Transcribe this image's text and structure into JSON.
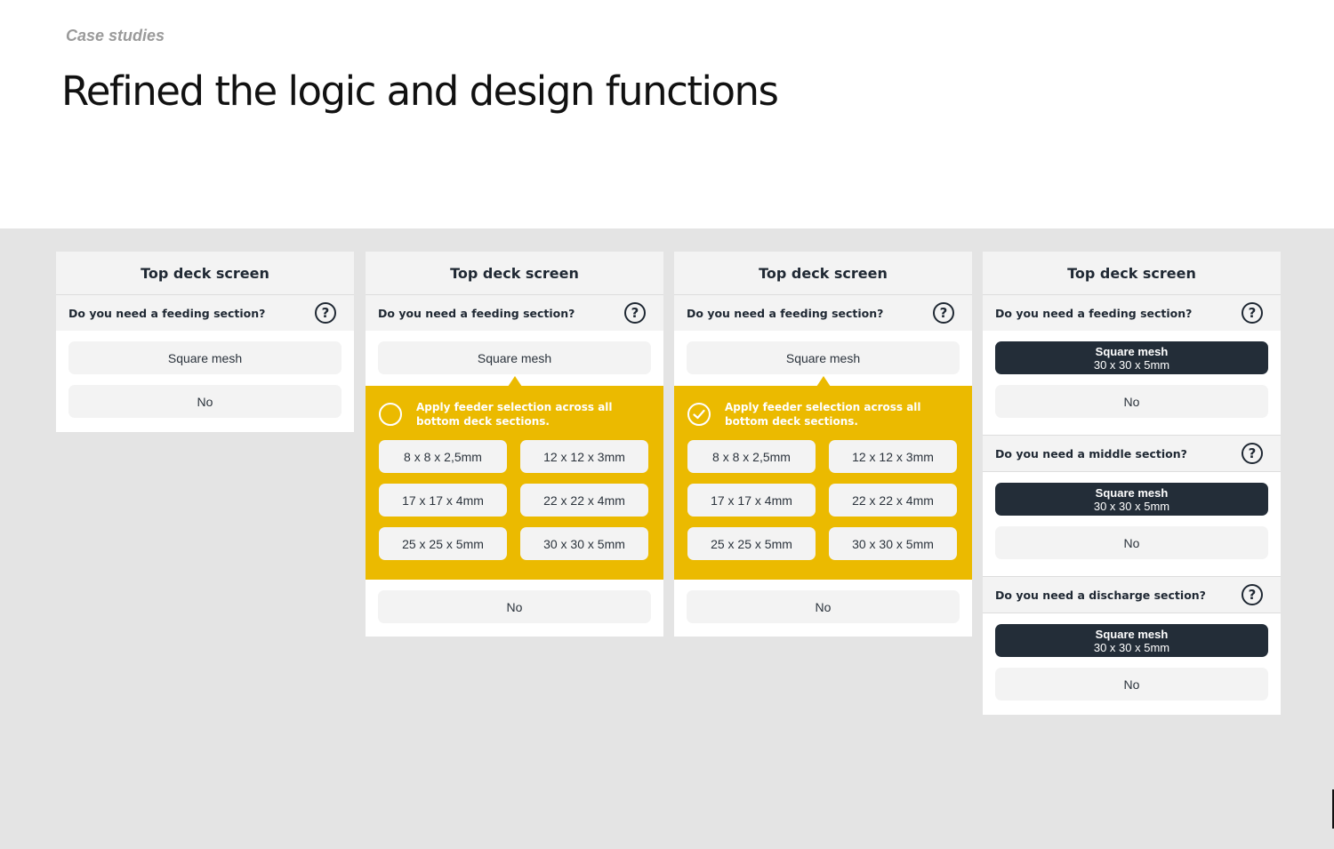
{
  "page": {
    "eyebrow": "Case studies",
    "title": "Refined the logic and design functions"
  },
  "panels": [
    {
      "header": "Top deck screen",
      "question": "Do you need a feeding section?",
      "help": "?",
      "option_square": "Square mesh",
      "option_no": "No"
    },
    {
      "header": "Top deck screen",
      "question": "Do you need a feeding section?",
      "help": "?",
      "option_square": "Square mesh",
      "apply_text": "Apply feeder selection across all bottom deck sections.",
      "apply_checked": false,
      "sizes": [
        "8 x 8 x 2,5mm",
        "12 x 12 x 3mm",
        "17 x 17 x 4mm",
        "22 x 22 x 4mm",
        "25 x 25  x 5mm",
        "30 x 30 x 5mm"
      ],
      "option_no": "No"
    },
    {
      "header": "Top deck screen",
      "question": "Do you need a feeding section?",
      "help": "?",
      "option_square": "Square mesh",
      "apply_text": "Apply feeder selection across all bottom deck sections.",
      "apply_checked": true,
      "sizes": [
        "8 x 8 x 2,5mm",
        "12 x 12 x 3mm",
        "17 x 17 x 4mm",
        "22 x 22 x 4mm",
        "25 x 25  x 5mm",
        "30 x 30 x 5mm"
      ],
      "option_no": "No"
    },
    {
      "header": "Top deck screen",
      "sections": [
        {
          "question": "Do you need a feeding section?",
          "help": "?",
          "selected_label": "Square mesh",
          "selected_size": "30 x 30 x 5mm",
          "option_no": "No"
        },
        {
          "question": "Do you need a middle section?",
          "help": "?",
          "selected_label": "Square mesh",
          "selected_size": "30 x 30 x 5mm",
          "option_no": "No"
        },
        {
          "question": "Do you need a discharge section?",
          "help": "?",
          "selected_label": "Square mesh",
          "selected_size": "30 x 30 x 5mm",
          "option_no": "No"
        }
      ]
    }
  ],
  "colors": {
    "accent_yellow": "#ebba00",
    "selected_dark": "#232d38",
    "background_gray": "#e4e4e4",
    "button_gray": "#f3f3f3"
  },
  "icons": [
    "question-circle-icon",
    "checkbox-circle-icon",
    "checkmark-icon"
  ]
}
